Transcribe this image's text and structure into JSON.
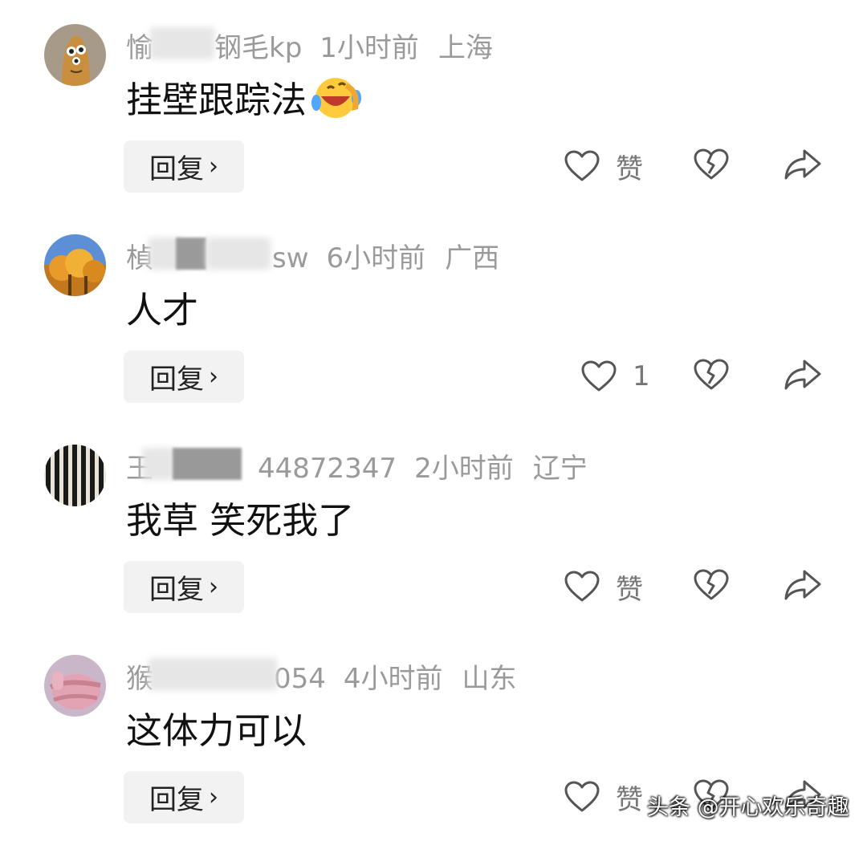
{
  "comments": [
    {
      "name_visible": "愉",
      "name_tail": "钢毛kp",
      "time": "1小时前",
      "location": "上海",
      "text": "挂壁跟踪法",
      "emoji": "laughing-crying-face",
      "reply_label": "回复",
      "like_label": "赞",
      "avatar": "cartoon-avatar"
    },
    {
      "name_visible": "楨",
      "name_tail": "sw",
      "time": "6小时前",
      "location": "广西",
      "text": "人才",
      "reply_label": "回复",
      "like_label": "1",
      "avatar": "autumn-tree-avatar"
    },
    {
      "name_visible": "王",
      "name_tail": "44872347",
      "time": "2小时前",
      "location": "辽宁",
      "text": "我草 笑死我了",
      "reply_label": "回复",
      "like_label": "赞",
      "avatar": "striped-avatar"
    },
    {
      "name_visible": "猴",
      "name_tail": "054",
      "time": "4小时前",
      "location": "山东",
      "text": "这体力可以",
      "reply_label": "回复",
      "like_label": "赞",
      "avatar": "hand-avatar"
    }
  ],
  "watermark": "头条 @开心欢乐奇趣",
  "colors": {
    "meta_text": "#9a9a9a",
    "body_text": "#111111",
    "reply_bg": "#f2f2f2",
    "icon_stroke": "#555555"
  }
}
